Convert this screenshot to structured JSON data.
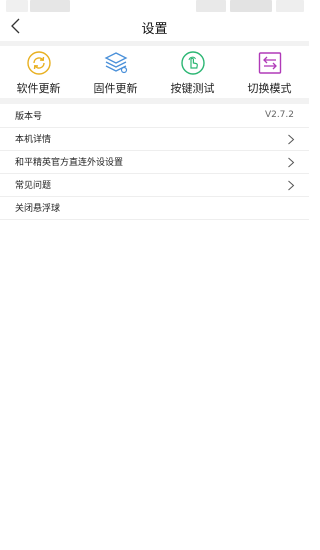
{
  "header": {
    "title": "设置"
  },
  "quick_actions": [
    {
      "label": "软件更新",
      "icon": "sync-icon",
      "color": "#e8b020"
    },
    {
      "label": "固件更新",
      "icon": "layers-icon",
      "color": "#4a90d9"
    },
    {
      "label": "按键测试",
      "icon": "finger-tap-icon",
      "color": "#2bb673"
    },
    {
      "label": "切换模式",
      "icon": "switch-arrows-icon",
      "color": "#b03ab8"
    }
  ],
  "settings": [
    {
      "label": "版本号",
      "value": "V2.7.2"
    },
    {
      "label": "本机详情"
    },
    {
      "label": "和平精英官方直连外设设置"
    },
    {
      "label": "常见问题"
    },
    {
      "label": "关闭悬浮球"
    }
  ]
}
